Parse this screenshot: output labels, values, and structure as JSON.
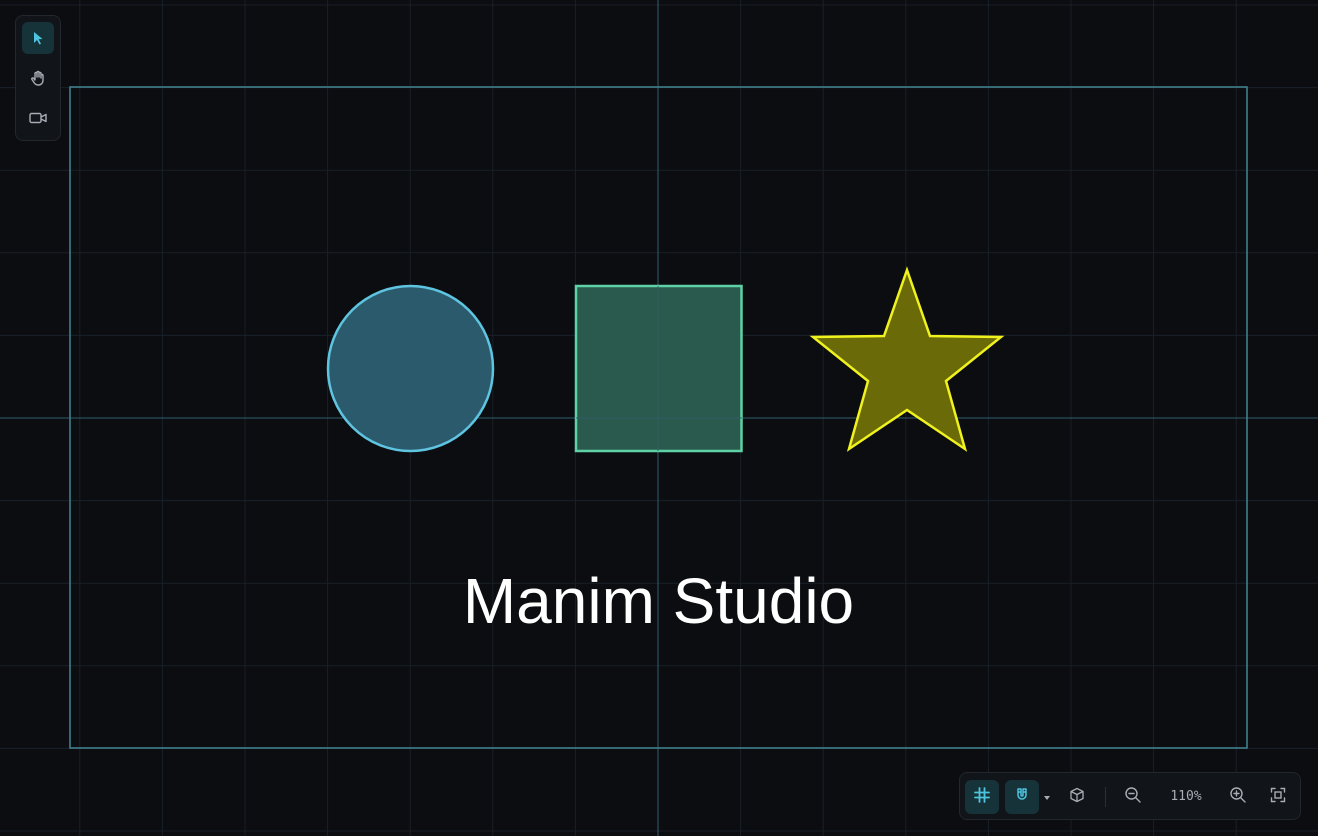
{
  "app": {
    "name": "Manim Studio"
  },
  "scene": {
    "title_text": "Manim Studio",
    "shapes": [
      {
        "kind": "circle",
        "name": "circle",
        "stroke": "#5ec4e0",
        "fill": "#2b5a6c"
      },
      {
        "kind": "square",
        "name": "square",
        "stroke": "#5fd1a6",
        "fill": "#2a5a4d"
      },
      {
        "kind": "star",
        "name": "star",
        "stroke": "#f0f21e",
        "fill": "#6a6a08"
      }
    ]
  },
  "colors": {
    "background": "#0b0d11",
    "grid": "#1a2028",
    "axis": "#2f5d6a",
    "frame": "#3f7f8c",
    "accent": "#4ec3de",
    "icon": "#a7adb5"
  },
  "tools": [
    {
      "id": "select",
      "icon": "cursor-arrow-icon",
      "active": true
    },
    {
      "id": "pan",
      "icon": "hand-icon",
      "active": false
    },
    {
      "id": "camera",
      "icon": "video-camera-icon",
      "active": false
    }
  ],
  "view_toolbar": {
    "grid_toggle": {
      "icon": "grid-hash-icon",
      "active": true
    },
    "snap_toggle": {
      "icon": "magnet-icon",
      "active": true
    },
    "snap_dropdown": {
      "icon": "caret-down-icon"
    },
    "view_3d": {
      "icon": "cube-icon"
    },
    "zoom_out": {
      "icon": "zoom-out-icon"
    },
    "zoom_level": "110%",
    "zoom_in": {
      "icon": "zoom-in-icon"
    },
    "fit_view": {
      "icon": "fit-frame-icon"
    }
  }
}
